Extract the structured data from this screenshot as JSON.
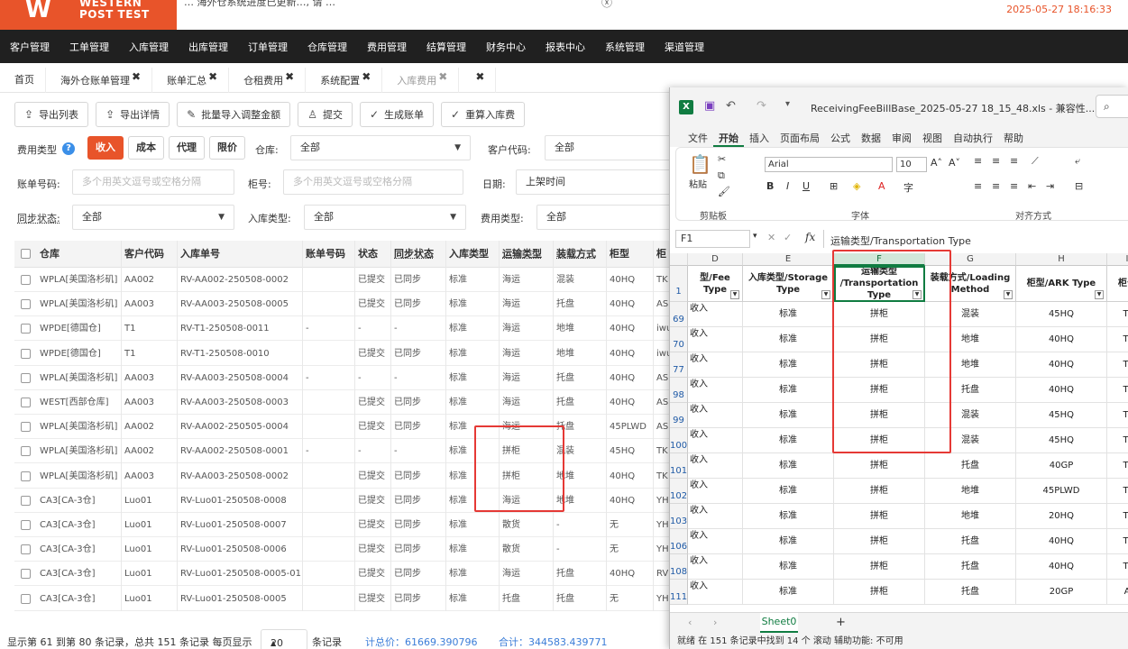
{
  "app": {
    "logo_line1": "WESTERN",
    "logo_line2": "POST TEST",
    "notice": "… 海外仓系统进度已更新…, 请 …",
    "datetime": "2025-05-27 18:16:33",
    "accent": "#e8542a"
  },
  "nav": [
    "客户管理",
    "工单管理",
    "入库管理",
    "出库管理",
    "订单管理",
    "仓库管理",
    "费用管理",
    "结算管理",
    "财务中心",
    "报表中心",
    "系统管理",
    "渠道管理"
  ],
  "tabs": [
    {
      "label": "首页",
      "close": ""
    },
    {
      "label": "海外仓账单管理",
      "close": "✖"
    },
    {
      "label": "账单汇总",
      "close": "✖"
    },
    {
      "label": "仓租费用",
      "close": "✖"
    },
    {
      "label": "系统配置",
      "close": "✖"
    },
    {
      "label": "入库费用",
      "close": "✖"
    },
    {
      "label": "",
      "close": "✖"
    }
  ],
  "toolbar": [
    "导出列表",
    "导出详情",
    "批量导入调整金额",
    "提交",
    "生成账单",
    "重算入库费"
  ],
  "filters": {
    "fee_type_label": "费用类型",
    "fee_types": [
      "收入",
      "成本",
      "代理",
      "限价"
    ],
    "warehouse_label": "仓库:",
    "warehouse_value": "全部",
    "customer_label": "客户代码:",
    "customer_value": "全部",
    "bill_no_label": "账单号码:",
    "bill_no_placeholder": "多个用英文逗号或空格分隔",
    "container_label": "柜号:",
    "container_placeholder": "多个用英文逗号或空格分隔",
    "date_label": "日期:",
    "date_value": "上架时间",
    "sync_label": "同步状态:",
    "sync_value": "全部",
    "inbound_type_label": "入库类型:",
    "inbound_type_value": "全部",
    "expense_type_label": "费用类型:",
    "expense_type_value": "全部"
  },
  "table": {
    "headers": [
      "仓库",
      "客户代码",
      "入库单号",
      "账单号码",
      "状态",
      "同步状态",
      "入库类型",
      "运输类型",
      "装载方式",
      "柜型",
      "柜"
    ],
    "rows": [
      [
        "WPLA[美国洛杉矶]",
        "AA002",
        "RV-AA002-250508-0002",
        "",
        "已提交",
        "已同步",
        "标准",
        "海运",
        "混装",
        "40HQ",
        "TK"
      ],
      [
        "WPLA[美国洛杉矶]",
        "AA003",
        "RV-AA003-250508-0005",
        "",
        "已提交",
        "已同步",
        "标准",
        "海运",
        "托盘",
        "40HQ",
        "AS"
      ],
      [
        "WPDE[德国仓]",
        "T1",
        "RV-T1-250508-0011",
        "-",
        "-",
        "-",
        "标准",
        "海运",
        "地堆",
        "40HQ",
        "iwu"
      ],
      [
        "WPDE[德国仓]",
        "T1",
        "RV-T1-250508-0010",
        "",
        "已提交",
        "已同步",
        "标准",
        "海运",
        "地堆",
        "40HQ",
        "iwu"
      ],
      [
        "WPLA[美国洛杉矶]",
        "AA003",
        "RV-AA003-250508-0004",
        "-",
        "-",
        "-",
        "标准",
        "海运",
        "托盘",
        "40HQ",
        "AS"
      ],
      [
        "WEST[西部仓库]",
        "AA003",
        "RV-AA003-250508-0003",
        "",
        "已提交",
        "已同步",
        "标准",
        "海运",
        "托盘",
        "40HQ",
        "AS"
      ],
      [
        "WPLA[美国洛杉矶]",
        "AA002",
        "RV-AA002-250505-0004",
        "",
        "已提交",
        "已同步",
        "标准",
        "海运",
        "托盘",
        "45PLWD",
        "AS"
      ],
      [
        "WPLA[美国洛杉矶]",
        "AA002",
        "RV-AA002-250508-0001",
        "-",
        "-",
        "-",
        "标准",
        "拼柜",
        "混装",
        "45HQ",
        "TK"
      ],
      [
        "WPLA[美国洛杉矶]",
        "AA003",
        "RV-AA003-250508-0002",
        "",
        "已提交",
        "已同步",
        "标准",
        "拼柜",
        "地堆",
        "40HQ",
        "TK"
      ],
      [
        "CA3[CA-3仓]",
        "Luo01",
        "RV-Luo01-250508-0008",
        "",
        "已提交",
        "已同步",
        "标准",
        "海运",
        "地堆",
        "40HQ",
        "YH"
      ],
      [
        "CA3[CA-3仓]",
        "Luo01",
        "RV-Luo01-250508-0007",
        "",
        "已提交",
        "已同步",
        "标准",
        "散货",
        "-",
        "无",
        "YH"
      ],
      [
        "CA3[CA-3仓]",
        "Luo01",
        "RV-Luo01-250508-0006",
        "",
        "已提交",
        "已同步",
        "标准",
        "散货",
        "-",
        "无",
        "YH"
      ],
      [
        "CA3[CA-3仓]",
        "Luo01",
        "RV-Luo01-250508-0005-01",
        "",
        "已提交",
        "已同步",
        "标准",
        "海运",
        "托盘",
        "40HQ",
        "RV"
      ],
      [
        "CA3[CA-3仓]",
        "Luo01",
        "RV-Luo01-250508-0005",
        "",
        "已提交",
        "已同步",
        "标准",
        "托盘",
        "托盘",
        "无",
        "YH"
      ]
    ]
  },
  "pagination": {
    "summary": "显示第 61 到第 80 条记录，总共 151 条记录 每页显示",
    "page_size": "20",
    "suffix": "条记录",
    "total_price": "计总价：61669.390796",
    "sum": "合计：344583.439771"
  },
  "excel": {
    "title": "ReceivingFeeBillBase_2025-05-27 18_15_48.xls - 兼容性...",
    "menu": [
      "文件",
      "开始",
      "插入",
      "页面布局",
      "公式",
      "数据",
      "审阅",
      "视图",
      "自动执行",
      "帮助"
    ],
    "ribbon": {
      "paste": "粘贴",
      "clipboard": "剪贴板",
      "font_group": "字体",
      "align_group": "对齐方式",
      "font_name": "Arial",
      "font_size": "10"
    },
    "name_box": "F1",
    "formula": "运输类型/Transportation Type",
    "columns": [
      "D",
      "E",
      "F",
      "G",
      "H",
      "I"
    ],
    "header_row": [
      "型/Fee Type",
      "入库类型/Storage Type",
      "运输类型 /Transportation Type",
      "装载方式/Loading Method",
      "柜型/ARK Type",
      "柜号"
    ],
    "row_numbers": [
      "69",
      "70",
      "77",
      "98",
      "99",
      "100",
      "101",
      "102",
      "103",
      "106",
      "108",
      "111"
    ],
    "rows": [
      [
        "收入",
        "标准",
        "拼柜",
        "混装",
        "45HQ",
        "Tl"
      ],
      [
        "收入",
        "标准",
        "拼柜",
        "地堆",
        "40HQ",
        "Tl"
      ],
      [
        "收入",
        "标准",
        "拼柜",
        "地堆",
        "40HQ",
        "Tl"
      ],
      [
        "收入",
        "标准",
        "拼柜",
        "托盘",
        "40HQ",
        "Tl"
      ],
      [
        "收入",
        "标准",
        "拼柜",
        "混装",
        "45HQ",
        "Tl"
      ],
      [
        "收入",
        "标准",
        "拼柜",
        "混装",
        "45HQ",
        "Tl"
      ],
      [
        "收入",
        "标准",
        "拼柜",
        "托盘",
        "40GP",
        "Tl"
      ],
      [
        "收入",
        "标准",
        "拼柜",
        "地堆",
        "45PLWD",
        "Tl"
      ],
      [
        "收入",
        "标准",
        "拼柜",
        "地堆",
        "20HQ",
        "Tl"
      ],
      [
        "收入",
        "标准",
        "拼柜",
        "托盘",
        "40HQ",
        "Tl"
      ],
      [
        "收入",
        "标准",
        "拼柜",
        "托盘",
        "40HQ",
        "Tl"
      ],
      [
        "收入",
        "标准",
        "拼柜",
        "托盘",
        "20GP",
        "A"
      ]
    ],
    "sheet": "Sheet0",
    "add_sheet": "+",
    "status": "就绪    在 151 条记录中找到 14 个    滚动    辅助功能: 不可用"
  }
}
